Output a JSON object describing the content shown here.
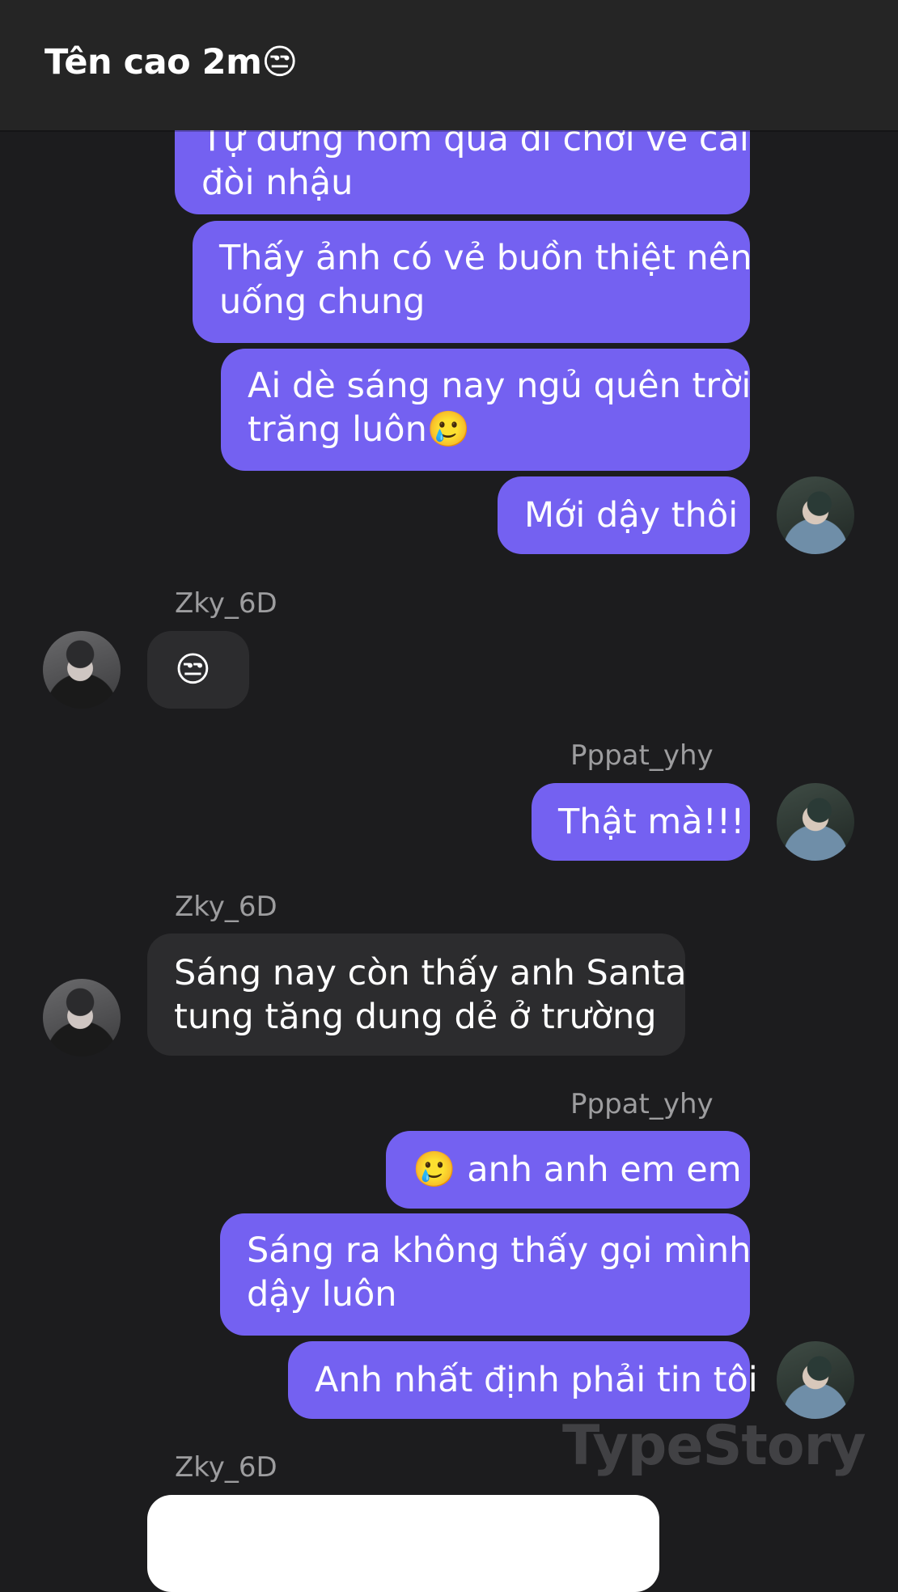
{
  "header": {
    "title": "Tên cao 2m😒"
  },
  "messages": [
    {
      "side": "out",
      "text_line1": "Tự dưng hôm qua đi chơi về cái",
      "text_line2": "đòi nhậu"
    },
    {
      "side": "out",
      "text_line1": "Thấy ảnh có vẻ buồn thiệt nên",
      "text_line2": "uống chung"
    },
    {
      "side": "out",
      "text_line1": "Ai dè sáng nay ngủ quên trời",
      "text_line2": "trăng luôn🥲"
    },
    {
      "side": "out",
      "text": "Mới dậy thôi"
    },
    {
      "side": "in",
      "sender": "Zky_6D",
      "text": "😒"
    },
    {
      "side": "out",
      "sender": "Pppat_yhy",
      "text": "Thật mà!!!"
    },
    {
      "side": "in",
      "sender": "Zky_6D",
      "text_line1": "Sáng nay còn thấy anh Santa",
      "text_line2": "tung tăng dung dẻ ở trường"
    },
    {
      "side": "out",
      "sender": "Pppat_yhy",
      "text": "🥲 anh anh em em"
    },
    {
      "side": "out",
      "text_line1": "Sáng ra không thấy gọi mình",
      "text_line2": "dậy luôn"
    },
    {
      "side": "out",
      "text": "Anh nhất định phải tin tôi"
    },
    {
      "side": "in",
      "sender": "Zky_6D"
    }
  ],
  "watermark": "TypeStory",
  "colors": {
    "outgoing_bubble": "#7461f1",
    "incoming_bubble": "#2c2c2e",
    "background": "#1c1c1e",
    "header": "#252525"
  }
}
